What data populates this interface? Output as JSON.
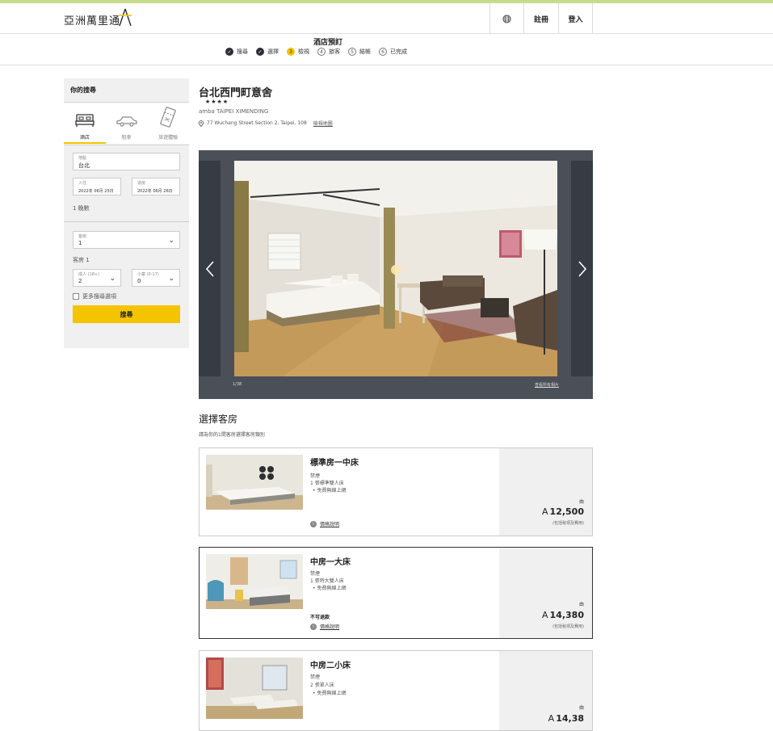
{
  "header": {
    "logo_text": "亞洲萬里通",
    "register": "註冊",
    "login": "登入"
  },
  "steps": {
    "title": "酒店預訂",
    "items": [
      {
        "label": "搜尋",
        "state": "done",
        "mark": "✓"
      },
      {
        "label": "選擇",
        "state": "done",
        "mark": "✓"
      },
      {
        "label": "檢視",
        "state": "current",
        "mark": "3"
      },
      {
        "label": "旅客",
        "state": "todo",
        "mark": "4"
      },
      {
        "label": "結帳",
        "state": "todo",
        "mark": "5"
      },
      {
        "label": "已完成",
        "state": "todo",
        "mark": "6"
      }
    ]
  },
  "sidebar": {
    "title": "你的搜尋",
    "tabs": [
      {
        "label": "酒店",
        "icon": "bed-icon"
      },
      {
        "label": "租車",
        "icon": "car-icon"
      },
      {
        "label": "旅遊體驗",
        "icon": "ticket-icon"
      }
    ],
    "destination": {
      "label": "地點",
      "value": "台北"
    },
    "checkin": {
      "label": "入住",
      "value": "2022年 06月 25日"
    },
    "checkout": {
      "label": "退房",
      "value": "2022年 06月 26日"
    },
    "nights": "1 晚數",
    "rooms": {
      "label": "客房",
      "value": "1"
    },
    "room_heading": "客房 1",
    "adults": {
      "label": "成人 (18+)",
      "value": "2"
    },
    "children": {
      "label": "小童 (0-17)",
      "value": "0"
    },
    "more_options": "更多搜尋選項",
    "search_button": "搜尋"
  },
  "hotel": {
    "name": "台北西門町意舍",
    "stars": "★★★★",
    "name_en": "amba TAIPEI XIMENDING",
    "address": "77 Wuchang Street Section 2, Taipei, 108",
    "map_link": "檢視地圖"
  },
  "gallery": {
    "counter": "1/38",
    "view_all": "查看所有相片"
  },
  "rooms": {
    "title": "選擇客房",
    "subtitle": "請為你的1間客房選擇客房類別",
    "list": [
      {
        "name": "標準房一中床",
        "smoking": "禁煙",
        "bed": "1 張標準雙人床",
        "feature": "•  免費無線上網",
        "note": "",
        "info": "價格說明",
        "from": "由",
        "currency": "A",
        "price": "12,500",
        "price_note": "(包括稅項及費用)"
      },
      {
        "name": "中房一大床",
        "smoking": "禁煙",
        "bed": "1 張特大雙人床",
        "feature": "•  免費無線上網",
        "note": "不可退款",
        "info": "價格說明",
        "from": "由",
        "currency": "A",
        "price": "14,380",
        "price_note": "(包括稅項及費用)"
      },
      {
        "name": "中房二小床",
        "smoking": "禁煙",
        "bed": "2 張單人床",
        "feature": "•  免費無線上網",
        "note": "",
        "info": "",
        "from": "由",
        "currency": "A",
        "price": "14,38",
        "price_note": ""
      }
    ]
  },
  "colors": {
    "accent": "#f5c400",
    "dark": "#2b2f36",
    "gallery_bg": "#4a4f58"
  }
}
